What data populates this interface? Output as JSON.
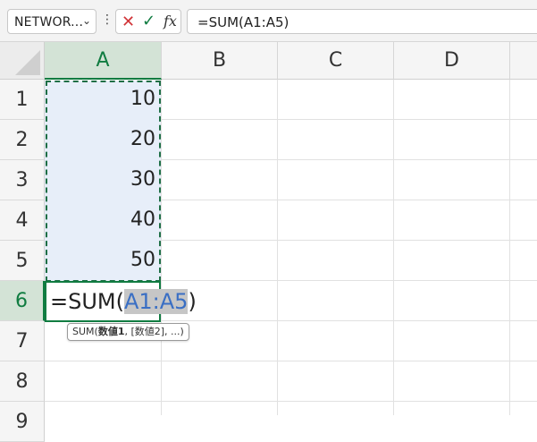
{
  "formula_bar": {
    "name_box": "NETWOR...",
    "formula": "=SUM(A1:A5)"
  },
  "columns": [
    "A",
    "B",
    "C",
    "D"
  ],
  "rows": [
    "1",
    "2",
    "3",
    "4",
    "5",
    "6",
    "7",
    "8",
    "9"
  ],
  "cells": {
    "A1": "10",
    "A2": "20",
    "A3": "30",
    "A4": "40",
    "A5": "50"
  },
  "editing": {
    "prefix": "=SUM(",
    "reference": "A1:A5",
    "suffix": ")"
  },
  "tooltip": {
    "func": "SUM(",
    "arg1": "数値1",
    "rest": ", [数値2], ...)"
  },
  "colors": {
    "accent": "#107c41",
    "selection_fill": "#e7eef9",
    "reference_text": "#3a6fc4",
    "cancel": "#d13438"
  },
  "icons": [
    "chevron-down-icon",
    "kebab-icon",
    "cancel-x-icon",
    "checkmark-icon",
    "fx-icon"
  ]
}
